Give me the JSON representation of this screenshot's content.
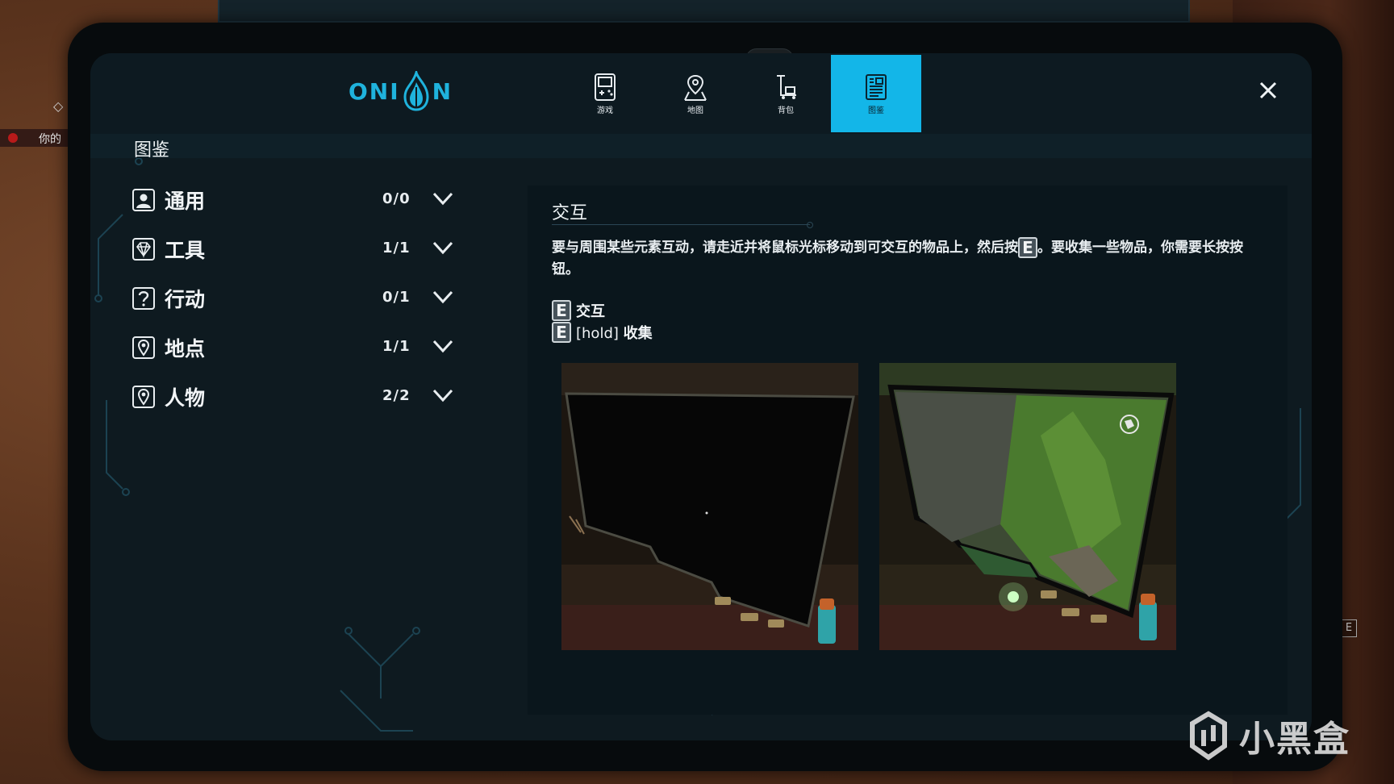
{
  "header": {
    "logo_left": "ONI",
    "logo_right": "N",
    "tabs": [
      {
        "label": "游戏",
        "icon": "gameboy-icon",
        "active": false
      },
      {
        "label": "地图",
        "icon": "map-pin-icon",
        "active": false
      },
      {
        "label": "背包",
        "icon": "cart-icon",
        "active": false
      },
      {
        "label": "图鉴",
        "icon": "document-icon",
        "active": true
      }
    ]
  },
  "section_title": "图鉴",
  "categories": [
    {
      "name": "通用",
      "count": "0/0",
      "icon": "person-card-icon"
    },
    {
      "name": "工具",
      "count": "1/1",
      "icon": "gem-icon"
    },
    {
      "name": "行动",
      "count": "0/1",
      "icon": "question-icon"
    },
    {
      "name": "地点",
      "count": "1/1",
      "icon": "location-icon"
    },
    {
      "name": "人物",
      "count": "2/2",
      "icon": "location-icon"
    }
  ],
  "detail": {
    "heading": "交互",
    "desc_part1": "要与周围某些元素互动，请走近并将鼠标光标移动到可交互的物品上，然后按",
    "desc_key": "E",
    "desc_part2": "。要收集一些物品，你需要长按按钮。",
    "bindings": [
      {
        "key": "E",
        "prefix": "",
        "label": "交互"
      },
      {
        "key": "E",
        "prefix": "[hold] ",
        "label": "收集"
      }
    ]
  },
  "side": {
    "hint_text": "你的",
    "e_key": "E"
  },
  "watermark": "小黑盒",
  "colors": {
    "accent": "#13b6e8",
    "panel": "#0e1a20",
    "circuit": "#1c4352"
  }
}
